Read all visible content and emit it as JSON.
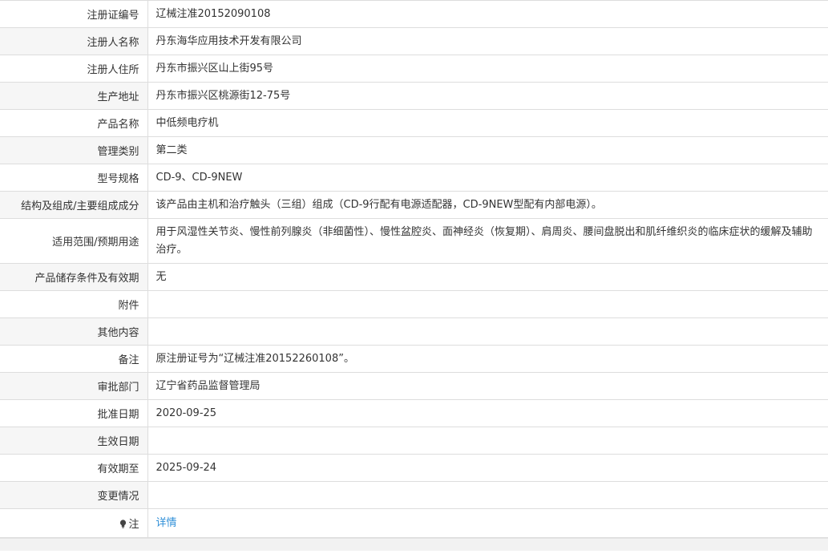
{
  "rows": [
    {
      "label": "注册证编号",
      "value": "辽械注准20152090108"
    },
    {
      "label": "注册人名称",
      "value": "丹东海华应用技术开发有限公司"
    },
    {
      "label": "注册人住所",
      "value": "丹东市振兴区山上街95号"
    },
    {
      "label": "生产地址",
      "value": "丹东市振兴区桃源街12-75号"
    },
    {
      "label": "产品名称",
      "value": "中低频电疗机"
    },
    {
      "label": "管理类别",
      "value": "第二类"
    },
    {
      "label": "型号规格",
      "value": "CD-9、CD-9NEW"
    },
    {
      "label": "结构及组成/主要组成成分",
      "value": "该产品由主机和治疗触头（三组）组成（CD-9行配有电源适配器，CD-9NEW型配有内部电源）。"
    },
    {
      "label": "适用范围/预期用途",
      "value": "用于风湿性关节炎、慢性前列腺炎（非细菌性）、慢性盆腔炎、面神经炎（恢复期）、肩周炎、腰间盘脱出和肌纤维织炎的临床症状的缓解及辅助治疗。"
    },
    {
      "label": "产品储存条件及有效期",
      "value": "无"
    },
    {
      "label": "附件",
      "value": ""
    },
    {
      "label": "其他内容",
      "value": ""
    },
    {
      "label": "备注",
      "value": "原注册证号为“辽械注准20152260108”。"
    },
    {
      "label": "审批部门",
      "value": "辽宁省药品监督管理局"
    },
    {
      "label": "批准日期",
      "value": "2020-09-25"
    },
    {
      "label": "生效日期",
      "value": ""
    },
    {
      "label": "有效期至",
      "value": "2025-09-24"
    },
    {
      "label": "变更情况",
      "value": ""
    }
  ],
  "note_row": {
    "label": "注",
    "icon": "lightbulb-icon",
    "link_text": "详情"
  }
}
